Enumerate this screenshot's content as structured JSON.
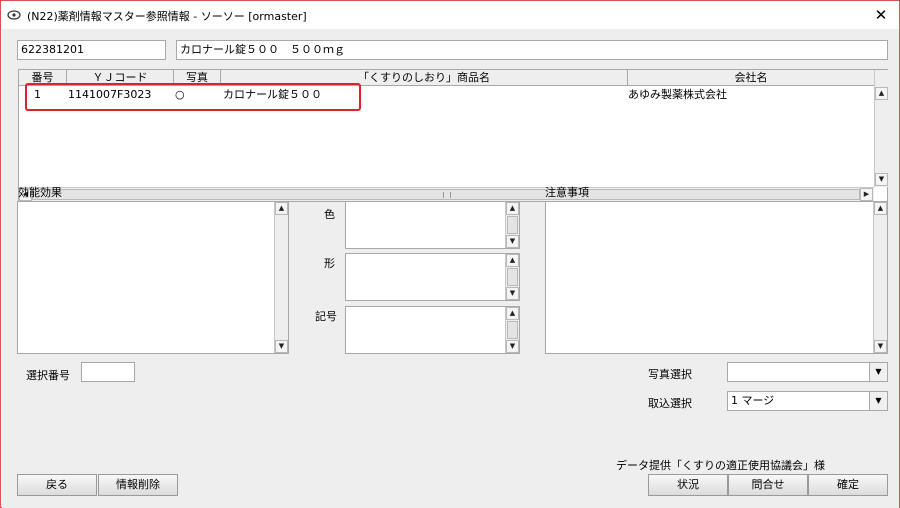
{
  "window": {
    "title": "(N22)薬剤情報マスター参照情報 - ソーソー [ormaster]",
    "close_glyph": "✕"
  },
  "header": {
    "code_value": "622381201",
    "name_value": "カロナール錠５００　５００ｍｇ"
  },
  "table": {
    "columns": [
      "番号",
      "ＹＪコード",
      "写真",
      "「くすりのしおり」商品名",
      "会社名"
    ],
    "rows": [
      {
        "no": "1",
        "yj_code": "1141007F3023",
        "photo": "○",
        "product_name": "カロナール錠５００",
        "company": "あゆみ製薬株式会社"
      }
    ]
  },
  "sections": {
    "efficacy_label": "効能効果",
    "color_label": "色",
    "shape_label": "形",
    "symbol_label": "記号",
    "caution_label": "注意事項",
    "select_no_label": "選択番号",
    "select_no_value": "",
    "photo_select_label": "写真選択",
    "photo_select_value": "",
    "import_select_label": "取込選択",
    "import_select_value": "1 マージ"
  },
  "footer": {
    "data_provider": "データ提供「くすりの適正使用協議会」様",
    "back_label": "戻る",
    "delete_label": "情報削除",
    "status_label": "状況",
    "inquiry_label": "問合せ",
    "confirm_label": "確定"
  },
  "icons": {
    "scroll_up": "▲",
    "scroll_down": "▼",
    "scroll_left": "◀",
    "scroll_right": "▶",
    "dropdown": "▼"
  },
  "colors": {
    "highlight": "#e0202a",
    "window_border": "#d9534f"
  }
}
